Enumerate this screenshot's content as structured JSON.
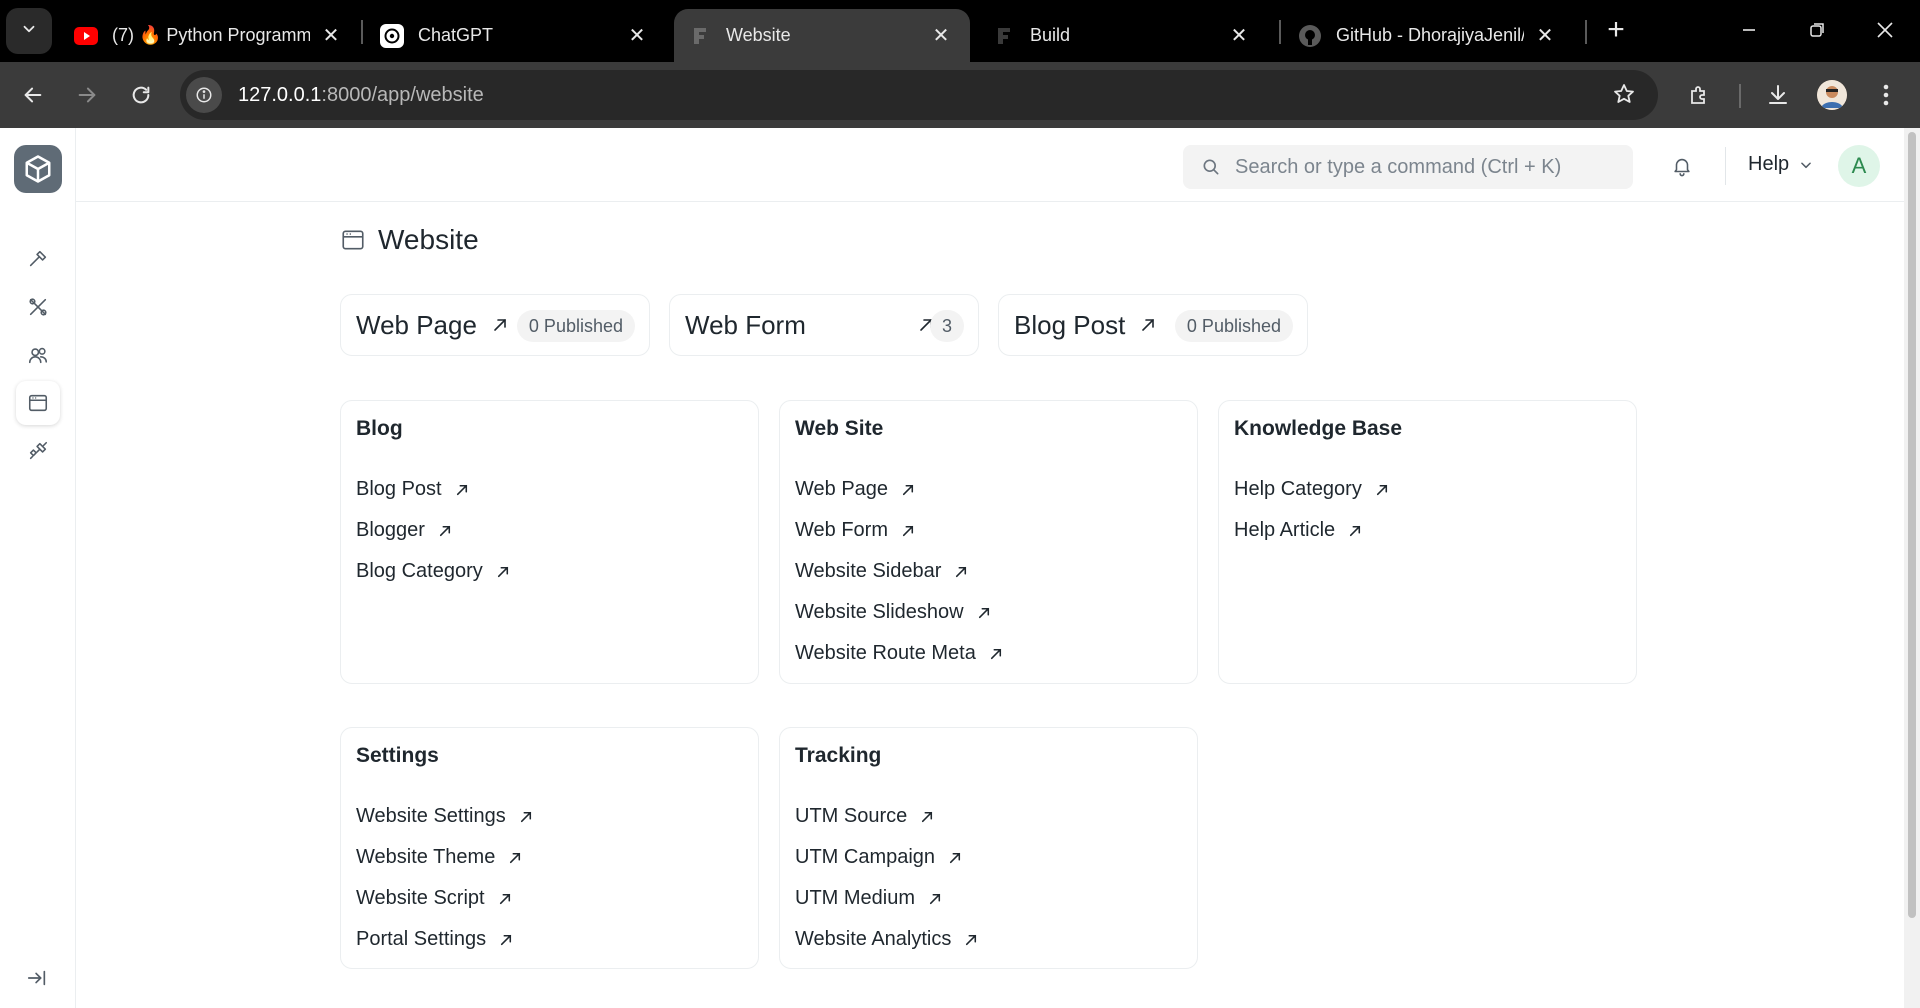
{
  "browser": {
    "tabs": [
      {
        "title": "(7) 🔥 Python Programm",
        "icon": "youtube-icon",
        "active": false
      },
      {
        "title": "ChatGPT",
        "icon": "chatgpt-icon",
        "active": false
      },
      {
        "title": "Website",
        "icon": "frappe-icon",
        "active": true
      },
      {
        "title": "Build",
        "icon": "frappe-icon",
        "active": false
      },
      {
        "title": "GitHub - DhorajiyaJenil/a",
        "icon": "github-icon",
        "active": false
      }
    ],
    "url_host": "127.0.0.1",
    "url_path": ":8000/app/website"
  },
  "topbar": {
    "search_placeholder": "Search or type a command (Ctrl + K)",
    "help_label": "Help",
    "user_initial": "A"
  },
  "sidebar": {
    "icons": [
      "build-icon",
      "tools-icon",
      "users-icon",
      "website-icon",
      "integrations-icon"
    ],
    "active": "website-icon"
  },
  "page": {
    "title": "Website"
  },
  "shortcuts": [
    {
      "label": "Web Page",
      "badge": "0 Published"
    },
    {
      "label": "Web Form",
      "badge": "3"
    },
    {
      "label": "Blog Post",
      "badge": "0 Published"
    }
  ],
  "cards": [
    {
      "title": "Blog",
      "links": [
        "Blog Post",
        "Blogger",
        "Blog Category"
      ]
    },
    {
      "title": "Web Site",
      "links": [
        "Web Page",
        "Web Form",
        "Website Sidebar",
        "Website Slideshow",
        "Website Route Meta"
      ]
    },
    {
      "title": "Knowledge Base",
      "links": [
        "Help Category",
        "Help Article"
      ]
    },
    {
      "title": "Settings",
      "links": [
        "Website Settings",
        "Website Theme",
        "Website Script",
        "Portal Settings"
      ]
    },
    {
      "title": "Tracking",
      "links": [
        "UTM Source",
        "UTM Campaign",
        "UTM Medium",
        "Website Analytics"
      ]
    }
  ]
}
